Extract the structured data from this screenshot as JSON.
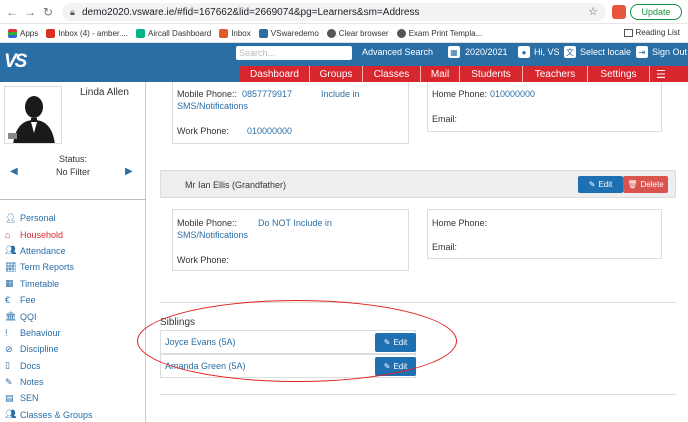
{
  "browser": {
    "url": "demo2020.vsware.ie/#fid=167662&lid=2669074&pg=Learners&sm=Address",
    "update_label": "Update",
    "bookmarks": [
      "Apps",
      "Inbox (4) - amber....",
      "Aircall Dashboard",
      "Inbox",
      "VSwaredemo",
      "Clear browser",
      "Exam Print Templa..."
    ],
    "reading_list": "Reading List"
  },
  "header": {
    "search_placeholder": "Search...",
    "advanced_search": "Advanced Search",
    "year": "2020/2021",
    "greeting": "Hi, VS",
    "select_locale": "Select locale",
    "sign_out": "Sign Out",
    "nav": [
      "Dashboard",
      "Groups",
      "Classes",
      "Mail",
      "Students",
      "Teachers",
      "Settings"
    ]
  },
  "sidebar": {
    "student_name": "Linda Allen",
    "status_label": "Status:",
    "filter_value": "No Filter",
    "menu": [
      "Personal",
      "Household",
      "Attendance",
      "Term Reports",
      "Timetable",
      "Fee",
      "QQI",
      "Behaviour",
      "Discipline",
      "Docs",
      "Notes",
      "SEN",
      "Classes & Groups"
    ]
  },
  "contact1": {
    "mobile_label": "Mobile Phone::",
    "mobile_value": "0857779917",
    "sms_line1": "Include in",
    "sms_line2": "SMS/Notifications",
    "work_label": "Work Phone:",
    "work_value": "010000000",
    "home_label": "Home Phone:",
    "home_value": "010000000",
    "email_label": "Email:"
  },
  "contact2": {
    "name": "Mr Ian Ellis (Grandfather)",
    "edit_label": "Edit",
    "delete_label": "Delete",
    "mobile_label": "Mobile Phone::",
    "sms_line1": "Do NOT Include in",
    "sms_line2": "SMS/Notifications",
    "work_label": "Work Phone:",
    "home_label": "Home Phone:",
    "email_label": "Email:"
  },
  "siblings": {
    "title": "Siblings",
    "edit_label": "Edit",
    "rows": [
      "Joyce Evans (5A)",
      "Amanda Green (5A)"
    ]
  }
}
